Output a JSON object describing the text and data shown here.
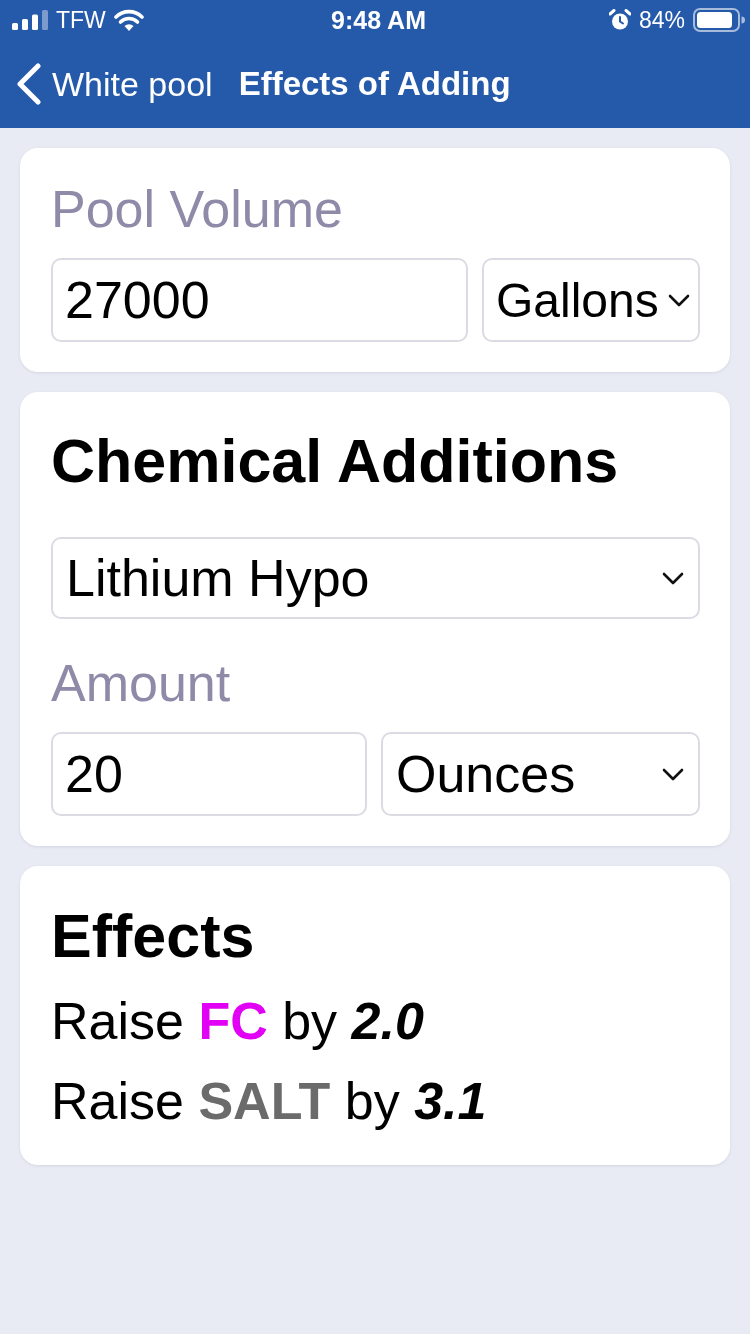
{
  "status_bar": {
    "carrier": "TFW",
    "time": "9:48 AM",
    "battery": "84%"
  },
  "nav_bar": {
    "back_label": "White pool",
    "title": "Effects of Adding"
  },
  "pool_volume": {
    "label": "Pool Volume",
    "value": "27000",
    "unit": "Gallons"
  },
  "chemical_additions": {
    "title": "Chemical Additions",
    "chemical": "Lithium Hypo",
    "amount_label": "Amount",
    "amount": "20",
    "unit": "Ounces"
  },
  "effects": {
    "title": "Effects",
    "items": [
      {
        "verb": "Raise",
        "parameter": "FC",
        "color": "#e100f5",
        "connector": "by",
        "value": "2.0"
      },
      {
        "verb": "Raise",
        "parameter": "SALT",
        "color": "#6b6b6b",
        "connector": "by",
        "value": "3.1"
      }
    ]
  }
}
